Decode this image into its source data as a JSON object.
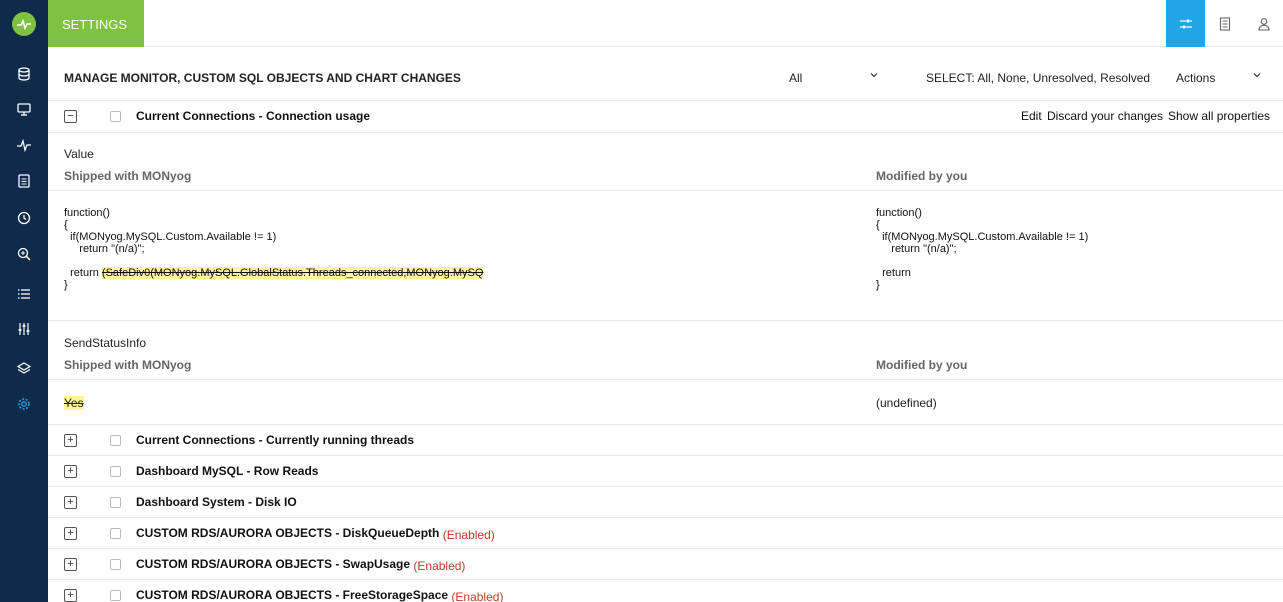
{
  "app": {
    "tab_label": "SETTINGS",
    "accent_green": "#7fc241",
    "accent_blue": "#1ea6e6",
    "sidebar_bg": "#0f2a4a"
  },
  "sidebar": {
    "items": [
      {
        "icon": "database-icon"
      },
      {
        "icon": "monitor-icon"
      },
      {
        "icon": "pulse-icon"
      },
      {
        "icon": "document-icon"
      },
      {
        "icon": "clock-icon"
      },
      {
        "icon": "zoom-icon"
      },
      {
        "icon": "list-icon"
      },
      {
        "icon": "sliders-icon"
      },
      {
        "icon": "layers-icon"
      },
      {
        "icon": "gear-icon"
      }
    ]
  },
  "topbar": {
    "buttons": [
      {
        "icon": "settings-sliders-icon",
        "active": true
      },
      {
        "icon": "report-icon",
        "active": false
      },
      {
        "icon": "user-icon",
        "active": false
      }
    ]
  },
  "header": {
    "title": "MANAGE MONITOR, CUSTOM SQL OBJECTS AND CHART CHANGES",
    "filter_value": "All",
    "select_text": "SELECT: All, None, Unresolved, Resolved",
    "actions_label": "Actions"
  },
  "expanded": {
    "title": "Current Connections - Connection usage",
    "links": {
      "edit": "Edit",
      "discard": "Discard your changes",
      "show_all": "Show all properties"
    },
    "value_section": {
      "label": "Value",
      "shipped_label": "Shipped with MONyog",
      "modified_label": "Modified by you",
      "shipped_code": {
        "line1": "function()",
        "line2": "{",
        "line3": "  if(MONyog.MySQL.Custom.Available != 1)",
        "line4": "     return \"(n/a)\";",
        "line5_prefix": "  return ",
        "line5_struck": "(SafeDiv0(MONyog.MySQL.GlobalStatus.Threads_connected,MONyog.MySQ",
        "line6": "}"
      },
      "modified_code": {
        "line1": "function()",
        "line2": "{",
        "line3": "  if(MONyog.MySQL.Custom.Available != 1)",
        "line4": "     return \"(n/a)\";",
        "line5": "  return",
        "line6": "}"
      }
    },
    "send_status_section": {
      "label": "SendStatusInfo",
      "shipped_label": "Shipped with MONyog",
      "modified_label": "Modified by you",
      "shipped_value": "Yes",
      "modified_value": "(undefined)"
    }
  },
  "collapsed_items": [
    {
      "title": "Current Connections - Currently running threads",
      "status": ""
    },
    {
      "title": "Dashboard MySQL - Row Reads",
      "status": ""
    },
    {
      "title": "Dashboard System - Disk IO",
      "status": ""
    },
    {
      "title": "CUSTOM RDS/AURORA OBJECTS - DiskQueueDepth",
      "status": "(Enabled)"
    },
    {
      "title": "CUSTOM RDS/AURORA OBJECTS - SwapUsage",
      "status": "(Enabled)"
    },
    {
      "title": "CUSTOM RDS/AURORA OBJECTS - FreeStorageSpace",
      "status": "(Enabled)"
    }
  ]
}
